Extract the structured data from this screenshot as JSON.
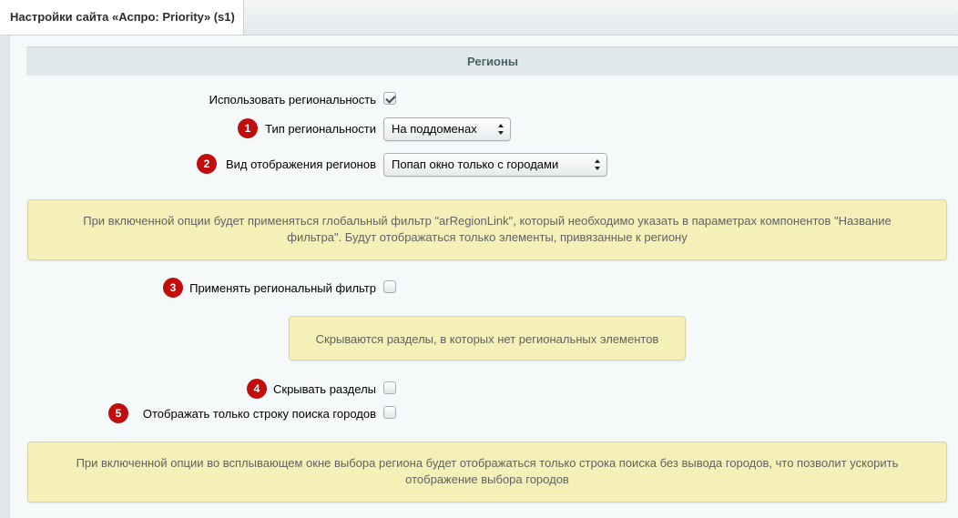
{
  "tab": {
    "title": "Настройки сайта «Аспро: Priority» (s1)"
  },
  "section": {
    "title": "Регионы"
  },
  "fields": {
    "use_regionality": {
      "label": "Использовать региональность",
      "checked": true
    },
    "regionality_type": {
      "badge": "1",
      "label": "Тип региональности",
      "value": "На поддоменах"
    },
    "regions_display": {
      "badge": "2",
      "label": "Вид отображения регионов",
      "value": "Попап окно только с городами"
    },
    "regional_filter": {
      "badge": "3",
      "label": "Применять региональный фильтр",
      "checked": false
    },
    "hide_sections": {
      "badge": "4",
      "label": "Скрывать разделы",
      "checked": false
    },
    "cities_search_only": {
      "badge": "5",
      "label": "Отображать только строку поиска городов",
      "checked": false
    }
  },
  "notes": {
    "filter_note": "При включенной опции будет применяться глобальный фильтр \"arRegionLink\", который необходимо указать в параметрах компонентов \"Название фильтра\". Будут отображаться только элементы, привязанные к региону",
    "hide_note": "Скрываются разделы, в которых нет региональных элементов",
    "search_note": "При включенной опции во всплывающем окне выбора региона будет отображаться только строка поиска без вывода городов, что позволит ускорить отображение выбора городов"
  },
  "colors": {
    "badge": "#c00d0d",
    "note_bg": "#f4f0b8",
    "header_bg": "#e0e8ea"
  }
}
